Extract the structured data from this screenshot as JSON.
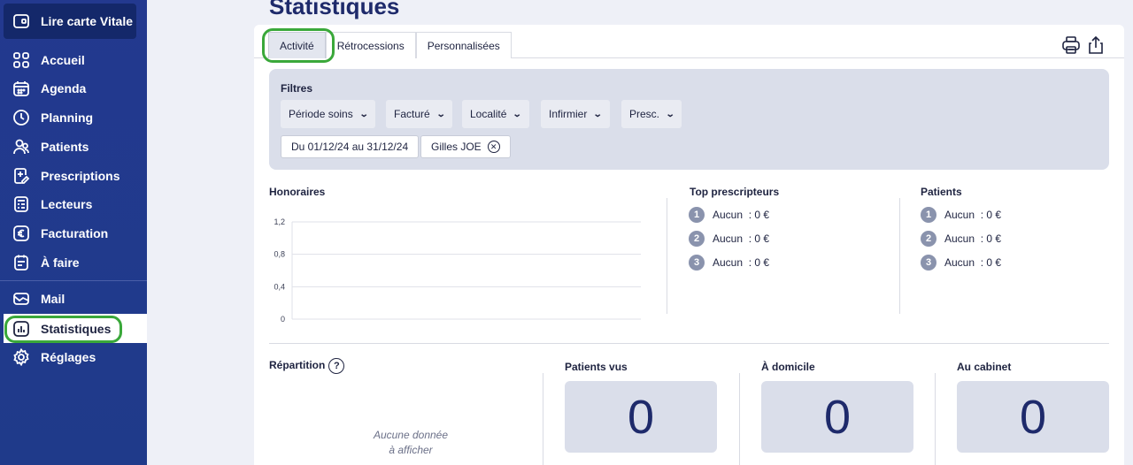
{
  "sidebar": {
    "vitale_label": "Lire carte Vitale",
    "items": [
      {
        "label": "Accueil",
        "icon": "grid-icon"
      },
      {
        "label": "Agenda",
        "icon": "calendar-icon"
      },
      {
        "label": "Planning",
        "icon": "clock-icon"
      },
      {
        "label": "Patients",
        "icon": "users-icon"
      },
      {
        "label": "Prescriptions",
        "icon": "prescription-icon"
      },
      {
        "label": "Lecteurs",
        "icon": "card-reader-icon"
      },
      {
        "label": "Facturation",
        "icon": "euro-icon"
      },
      {
        "label": "À faire",
        "icon": "todo-icon"
      },
      {
        "label": "Mail",
        "icon": "mail-icon"
      },
      {
        "label": "Statistiques",
        "icon": "chart-icon"
      },
      {
        "label": "Réglages",
        "icon": "gear-icon"
      }
    ]
  },
  "page": {
    "title": "Statistiques"
  },
  "tabs": [
    {
      "label": "Activité"
    },
    {
      "label": "Rétrocessions"
    },
    {
      "label": "Personnalisées"
    }
  ],
  "filters": {
    "label": "Filtres",
    "dropdowns": [
      "Période soins",
      "Facturé",
      "Localité",
      "Infirmier",
      "Presc."
    ],
    "chips": [
      "Du 01/12/24 au 31/12/24",
      "Gilles JOE"
    ]
  },
  "honoraires": {
    "title": "Honoraires",
    "chart_data": {
      "type": "line",
      "title": "Honoraires",
      "y_ticks": [
        "1,2",
        "0,8",
        "0,4",
        "0"
      ],
      "ylim": [
        0,
        1.2
      ],
      "series": []
    }
  },
  "top_prescripteurs": {
    "title": "Top prescripteurs",
    "rows": [
      {
        "rank": "1",
        "name": "Aucun",
        "value": ": 0 €"
      },
      {
        "rank": "2",
        "name": "Aucun",
        "value": ": 0 €"
      },
      {
        "rank": "3",
        "name": "Aucun",
        "value": ": 0 €"
      }
    ]
  },
  "patients_top": {
    "title": "Patients",
    "rows": [
      {
        "rank": "1",
        "name": "Aucun",
        "value": ": 0 €"
      },
      {
        "rank": "2",
        "name": "Aucun",
        "value": ": 0 €"
      },
      {
        "rank": "3",
        "name": "Aucun",
        "value": ": 0 €"
      }
    ]
  },
  "repartition": {
    "title": "Répartition",
    "help": "?",
    "empty_line1": "Aucune donnée",
    "empty_line2": "à afficher"
  },
  "kpis": [
    {
      "title": "Patients vus",
      "value": "0"
    },
    {
      "title": "À domicile",
      "value": "0"
    },
    {
      "title": "Au cabinet",
      "value": "0"
    }
  ]
}
